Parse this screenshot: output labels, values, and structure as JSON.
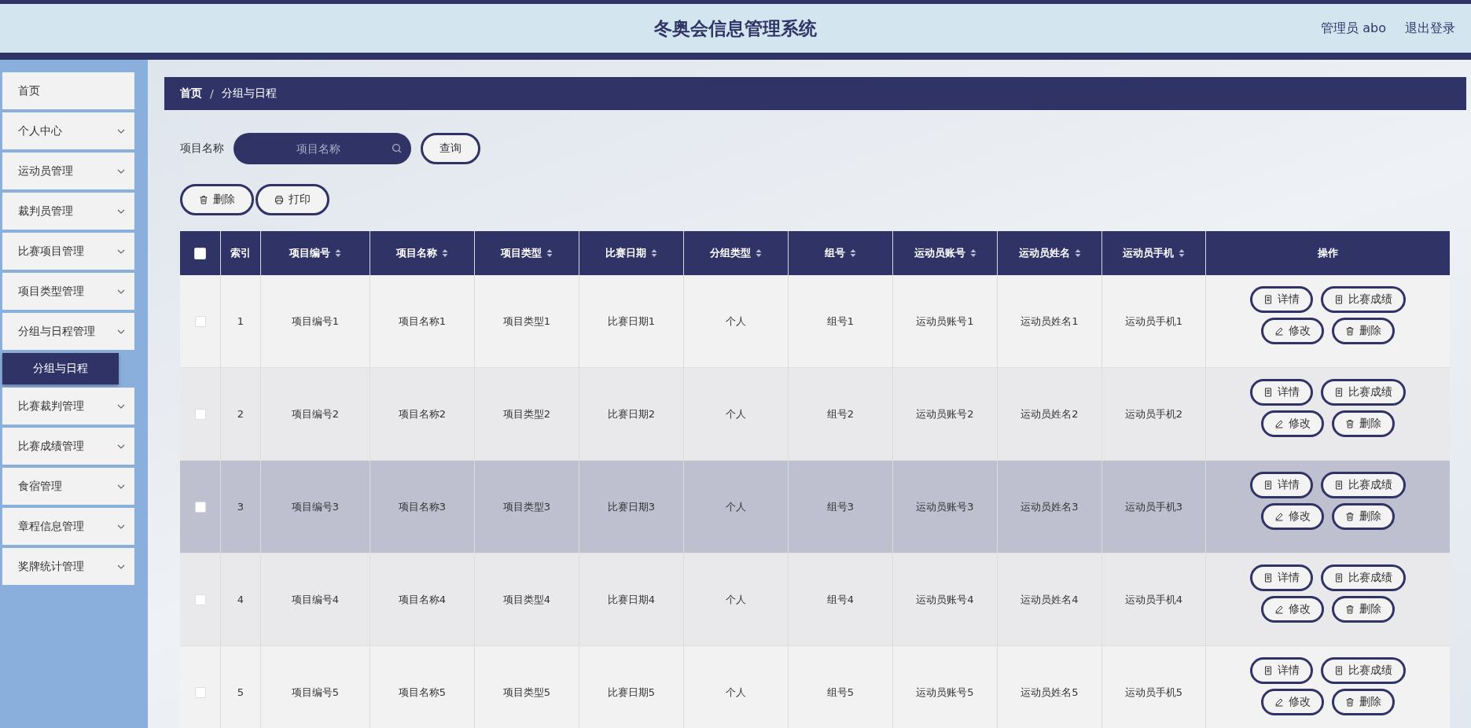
{
  "header": {
    "title": "冬奥会信息管理系统",
    "user": "管理员 abo",
    "logout": "退出登录"
  },
  "sidebar": {
    "items": [
      {
        "label": "首页",
        "expandable": false
      },
      {
        "label": "个人中心",
        "expandable": true,
        "expanded": false
      },
      {
        "label": "运动员管理",
        "expandable": true,
        "expanded": false
      },
      {
        "label": "裁判员管理",
        "expandable": true,
        "expanded": false
      },
      {
        "label": "比赛项目管理",
        "expandable": true,
        "expanded": false
      },
      {
        "label": "项目类型管理",
        "expandable": true,
        "expanded": false
      },
      {
        "label": "分组与日程管理",
        "expandable": true,
        "expanded": true,
        "children": [
          {
            "label": "分组与日程",
            "selected": true
          }
        ]
      },
      {
        "label": "比赛裁判管理",
        "expandable": true,
        "expanded": false
      },
      {
        "label": "比赛成绩管理",
        "expandable": true,
        "expanded": false
      },
      {
        "label": "食宿管理",
        "expandable": true,
        "expanded": false
      },
      {
        "label": "章程信息管理",
        "expandable": true,
        "expanded": false
      },
      {
        "label": "奖牌统计管理",
        "expandable": true,
        "expanded": false
      }
    ]
  },
  "breadcrumb": {
    "items": [
      {
        "label": "首页",
        "current": false
      },
      {
        "label": "分组与日程",
        "current": true
      }
    ],
    "separator": "/"
  },
  "search": {
    "label": "项目名称",
    "placeholder": "项目名称",
    "button": "查询"
  },
  "toolbar": [
    {
      "kind": "delete",
      "label": "删除"
    },
    {
      "kind": "print",
      "label": "打印"
    }
  ],
  "table": {
    "select_all": {
      "checked": false
    },
    "columns": [
      {
        "label": "索引",
        "sortable": false
      },
      {
        "label": "项目编号",
        "sortable": true
      },
      {
        "label": "项目名称",
        "sortable": true
      },
      {
        "label": "项目类型",
        "sortable": true
      },
      {
        "label": "比赛日期",
        "sortable": true
      },
      {
        "label": "分组类型",
        "sortable": true
      },
      {
        "label": "组号",
        "sortable": true
      },
      {
        "label": "运动员账号",
        "sortable": true
      },
      {
        "label": "运动员姓名",
        "sortable": true
      },
      {
        "label": "运动员手机",
        "sortable": true
      },
      {
        "label": "操作",
        "sortable": false
      }
    ],
    "rows": [
      {
        "checked": false,
        "highlighted": false,
        "cells": [
          "1",
          "项目编号1",
          "项目名称1",
          "项目类型1",
          "比赛日期1",
          "个人",
          "组号1",
          "运动员账号1",
          "运动员姓名1",
          "运动员手机1"
        ],
        "actions": [
          {
            "kind": "detail",
            "label": "详情"
          },
          {
            "kind": "detail",
            "label": "比赛成绩"
          },
          {
            "kind": "edit",
            "label": "修改"
          },
          {
            "kind": "delete",
            "label": "删除"
          }
        ]
      },
      {
        "checked": false,
        "highlighted": false,
        "cells": [
          "2",
          "项目编号2",
          "项目名称2",
          "项目类型2",
          "比赛日期2",
          "个人",
          "组号2",
          "运动员账号2",
          "运动员姓名2",
          "运动员手机2"
        ],
        "actions": [
          {
            "kind": "detail",
            "label": "详情"
          },
          {
            "kind": "detail",
            "label": "比赛成绩"
          },
          {
            "kind": "edit",
            "label": "修改"
          },
          {
            "kind": "delete",
            "label": "删除"
          }
        ]
      },
      {
        "checked": false,
        "highlighted": true,
        "cells": [
          "3",
          "项目编号3",
          "项目名称3",
          "项目类型3",
          "比赛日期3",
          "个人",
          "组号3",
          "运动员账号3",
          "运动员姓名3",
          "运动员手机3"
        ],
        "actions": [
          {
            "kind": "detail",
            "label": "详情"
          },
          {
            "kind": "detail",
            "label": "比赛成绩"
          },
          {
            "kind": "edit",
            "label": "修改"
          },
          {
            "kind": "delete",
            "label": "删除"
          }
        ]
      },
      {
        "checked": false,
        "highlighted": false,
        "cells": [
          "4",
          "项目编号4",
          "项目名称4",
          "项目类型4",
          "比赛日期4",
          "个人",
          "组号4",
          "运动员账号4",
          "运动员姓名4",
          "运动员手机4"
        ],
        "actions": [
          {
            "kind": "detail",
            "label": "详情"
          },
          {
            "kind": "detail",
            "label": "比赛成绩"
          },
          {
            "kind": "edit",
            "label": "修改"
          },
          {
            "kind": "delete",
            "label": "删除"
          }
        ]
      },
      {
        "checked": false,
        "highlighted": false,
        "cells": [
          "5",
          "项目编号5",
          "项目名称5",
          "项目类型5",
          "比赛日期5",
          "个人",
          "组号5",
          "运动员账号5",
          "运动员姓名5",
          "运动员手机5"
        ],
        "actions": [
          {
            "kind": "detail",
            "label": "详情"
          },
          {
            "kind": "detail",
            "label": "比赛成绩"
          },
          {
            "kind": "edit",
            "label": "修改"
          },
          {
            "kind": "delete",
            "label": "删除"
          }
        ]
      }
    ]
  }
}
